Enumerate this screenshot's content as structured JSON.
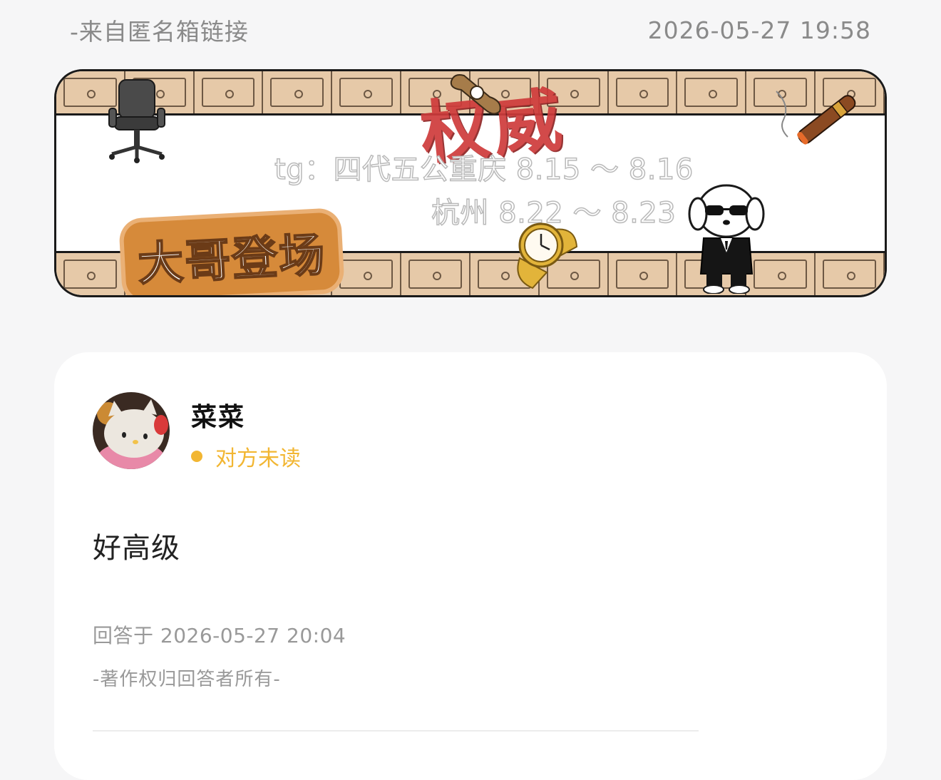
{
  "header": {
    "source": "-来自匿名箱链接",
    "timestamp": "2026-05-27 19:58"
  },
  "banner": {
    "title": "权威",
    "line1": "tg：四代五公重庆 8.15 ～ 8.16",
    "line2": "杭州 8.22 ～ 8.23",
    "badge": "大哥登场",
    "icons": [
      "office-chair-icon",
      "cigar-cutter-icon",
      "cigar-icon",
      "gold-watch-icon",
      "dog-in-suit-icon"
    ]
  },
  "card": {
    "username": "菜菜",
    "status": "对方未读",
    "answer": "好高级",
    "answered_time": "回答于 2026-05-27 20:04",
    "copyright": "-著作权归回答者所有-"
  },
  "colors": {
    "status": "#f2b632",
    "banner_title": "#cf3b3b",
    "drawer": "#e6c9a8",
    "badge": "#d68a3a"
  }
}
